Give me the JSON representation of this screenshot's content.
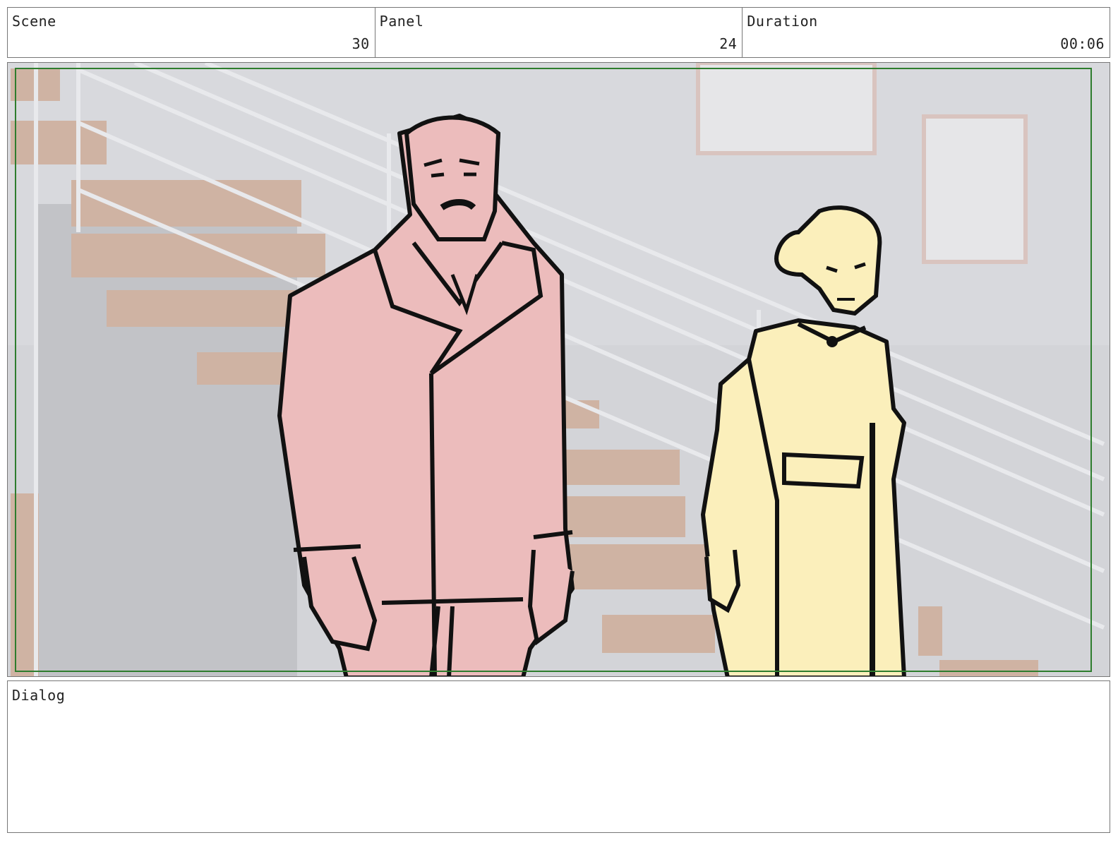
{
  "header": {
    "scene_label": "Scene",
    "scene_value": "30",
    "panel_label": "Panel",
    "panel_value": "24",
    "duration_label": "Duration",
    "duration_value": "00:06"
  },
  "dialog": {
    "label": "Dialog",
    "text": ""
  },
  "colors": {
    "safe_frame": "#2e7d2e",
    "background_wall": "#d3d4d8",
    "stairs": "#cfb3a3",
    "man_fill": "#ecbcbc",
    "woman_fill": "#fbefbb",
    "ink": "#111111"
  }
}
